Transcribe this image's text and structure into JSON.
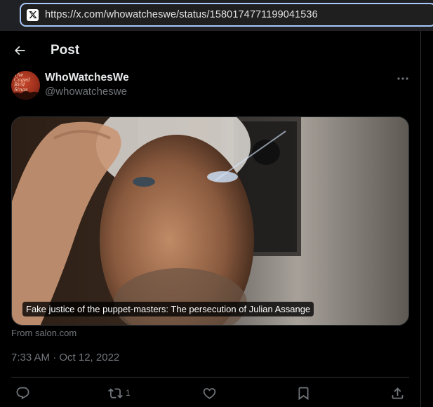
{
  "browser": {
    "url": "https://x.com/whowatcheswe/status/1580174771199041536",
    "site_icon": "x-logo-icon"
  },
  "header": {
    "title": "Post",
    "back_icon": "back-arrow-icon"
  },
  "author": {
    "display_name": "WhoWatchesWe",
    "handle": "@whowatcheswe",
    "avatar_text": "The Caged Bird Sings"
  },
  "card": {
    "caption": "Fake justice of the puppet-masters: The persecution of Julian Assange",
    "source": "From salon.com"
  },
  "timestamp": "7:33 AM · Oct 12, 2022",
  "actions": {
    "reply": {
      "icon": "reply-icon",
      "count": ""
    },
    "repost": {
      "icon": "repost-icon",
      "count": "1"
    },
    "like": {
      "icon": "heart-icon",
      "count": ""
    },
    "bookmark": {
      "icon": "bookmark-icon",
      "count": ""
    },
    "share": {
      "icon": "share-icon",
      "count": ""
    }
  },
  "colors": {
    "background": "#000000",
    "text_primary": "#e7e9ea",
    "text_secondary": "#71767b",
    "border": "#2f3336",
    "url_focus": "#a8c7fa"
  }
}
